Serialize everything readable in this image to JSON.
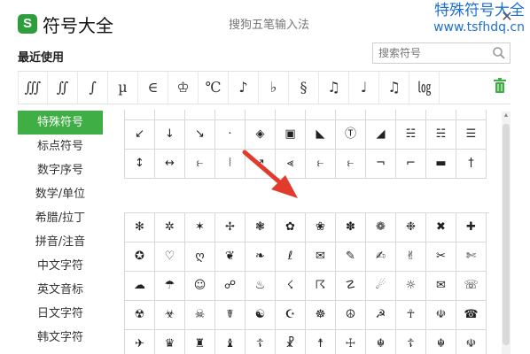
{
  "app": {
    "logo": "S",
    "title": "符号大全",
    "ime_name": "搜狗五笔输入法",
    "close": "✕"
  },
  "watermark": {
    "line1": "特殊符号大全",
    "line2": "www.tsfhdq.cn"
  },
  "recent": {
    "label": "最近使用",
    "items": [
      "∭",
      "∬",
      "∫",
      "µ",
      "∈",
      "♔",
      "℃",
      "♪",
      "♭",
      "§",
      "♫",
      "♩",
      "♫",
      "㏒"
    ]
  },
  "search": {
    "placeholder": "搜索符号"
  },
  "sidebar": {
    "items": [
      {
        "label": "特殊符号"
      },
      {
        "label": "标点符号"
      },
      {
        "label": "数字序号"
      },
      {
        "label": "数学/单位"
      },
      {
        "label": "希腊/拉丁"
      },
      {
        "label": "拼音/注音"
      },
      {
        "label": "中文字符"
      },
      {
        "label": "英文音标"
      },
      {
        "label": "日文字符"
      },
      {
        "label": "韩文字符"
      }
    ]
  },
  "grid_top": [
    [
      "·",
      "·",
      "·",
      "·",
      "·",
      "·",
      "·",
      "·",
      "·",
      "·",
      "·",
      "·"
    ],
    [
      "↙",
      "↓",
      "↘",
      "·",
      "◈",
      "▣",
      "◣",
      "Ⓣ",
      "◢",
      "☵",
      "☵",
      "☰"
    ],
    [
      "↕",
      "↔",
      "⥼",
      "⦚",
      "↗",
      "⪡",
      "⥼",
      "⥼",
      "¬",
      "⌐",
      "▬",
      "†",
      "‡"
    ]
  ],
  "grid_bottom": [
    [
      "✻",
      "✲",
      "✶",
      "✢",
      "❃",
      "✿",
      "❀",
      "✽",
      "❁",
      "❉",
      "✖",
      "✚"
    ],
    [
      "✪",
      "♡",
      "ღ",
      "❦",
      "❧",
      "ℓ",
      "✉",
      "✎",
      "✍",
      "✌",
      "✂",
      "✄"
    ],
    [
      "☁",
      "☂",
      "☺",
      "☍",
      "♨",
      "☇",
      "☈",
      "☡",
      "☄",
      "☼",
      "✉",
      "☏"
    ],
    [
      "☢",
      "☣",
      "☠",
      "☤",
      "☯",
      "☪",
      "☸",
      "☮",
      "☭",
      "☥",
      "☫",
      "☎"
    ],
    [
      "✈",
      "♛",
      "♜",
      "♝",
      "☦",
      "☧",
      "☨",
      "☩",
      "☬",
      "☦",
      "☬",
      "☫"
    ]
  ]
}
